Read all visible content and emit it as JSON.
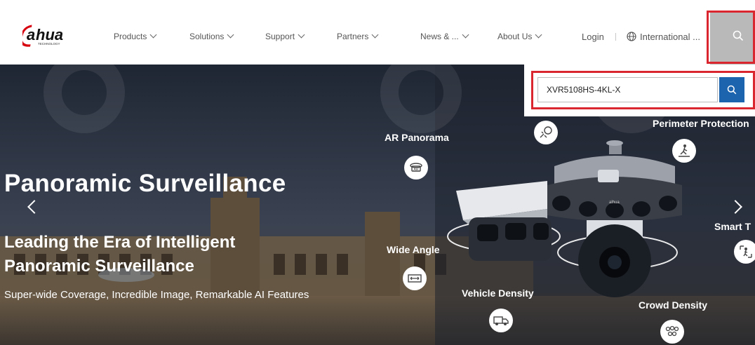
{
  "brand": {
    "logo_text": "alhua",
    "logo_sub": "TECHNOLOGY"
  },
  "nav": {
    "items": [
      {
        "label": "Products"
      },
      {
        "label": "Solutions"
      },
      {
        "label": "Support"
      },
      {
        "label": "Partners"
      },
      {
        "label": "News & ..."
      },
      {
        "label": "About Us"
      }
    ],
    "login": "Login",
    "region": "International ..."
  },
  "search": {
    "value": "XVR5108HS-4KL-X"
  },
  "hero": {
    "title": "Panoramic Surveillance",
    "headline_lines": [
      "Leading the Era of Intelligent",
      "Panoramic Surveillance"
    ],
    "subtitle": "Super-wide Coverage, Incredible Image, Remarkable AI Features"
  },
  "features": {
    "ar_panorama": "AR Panorama",
    "perimeter_protection": "Perimeter Protection",
    "wide_angle": "Wide Angle",
    "vehicle_density": "Vehicle Density",
    "crowd_density": "Crowd Density",
    "smart_tracking": "Smart T"
  },
  "colors": {
    "accent_blue": "#1c64ae",
    "highlight_red": "#d9262f",
    "brand_red": "#d7000f"
  }
}
